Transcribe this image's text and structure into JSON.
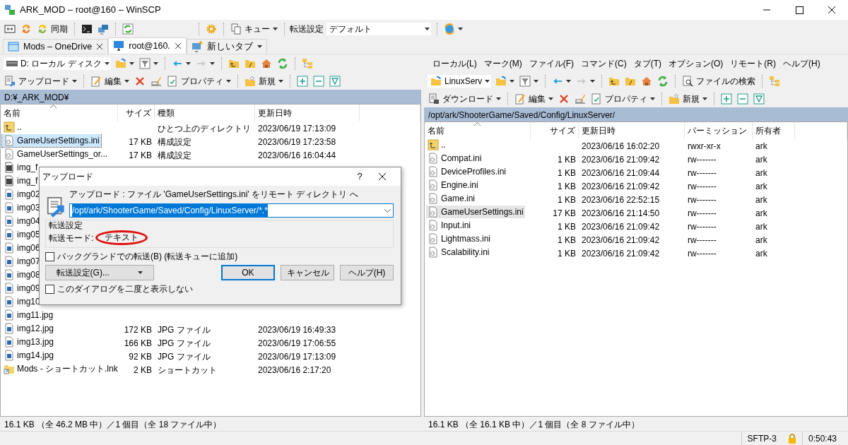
{
  "window": {
    "title": "ARK_MOD – root@160 – WinSCP"
  },
  "main_toolbar": [
    {
      "kind": "icon",
      "dropdown": false
    },
    {
      "kind": "icon",
      "dropdown": false
    },
    {
      "kind": "button",
      "label": "同期",
      "dropdown": false
    },
    {
      "kind": "icon",
      "dropdown": false
    },
    {
      "kind": "icon",
      "dropdown": false
    },
    {
      "kind": "icon",
      "dropdown": false
    },
    {
      "kind": "icon",
      "dropdown": false
    },
    {
      "kind": "button",
      "label": "キュー",
      "dropdown": true
    },
    {
      "kind": "label",
      "label": "転送設定"
    },
    {
      "kind": "combo",
      "value": "デフォルト"
    },
    {
      "kind": "icon",
      "dropdown": true
    }
  ],
  "tabs": [
    {
      "label": "Mods – OneDrive",
      "selected": false,
      "closable": true,
      "dropdown": false
    },
    {
      "label": "root@160.",
      "selected": true,
      "closable": true,
      "dropdown": false
    },
    {
      "label": "新しいタブ",
      "selected": false,
      "closable": false,
      "dropdown": true
    }
  ],
  "left_panel": {
    "toolbar_1": [
      {
        "kind": "combo",
        "value": "D: ローカル ディスク"
      },
      {
        "kind": "icon",
        "dropdown": true
      },
      {
        "kind": "icon",
        "dropdown": true
      },
      {
        "kind": "icon",
        "dropdown": true
      },
      {
        "kind": "icon",
        "dropdown": true
      },
      {
        "kind": "icon",
        "dropdown": false
      },
      {
        "kind": "icon",
        "dropdown": false
      },
      {
        "kind": "icon",
        "dropdown": false
      },
      {
        "kind": "icon",
        "dropdown": false
      },
      {
        "kind": "icon",
        "dropdown": false
      }
    ],
    "toolbar_2": [
      {
        "kind": "button",
        "label": "アップロード",
        "dropdown": true
      },
      {
        "kind": "button",
        "label": "編集",
        "dropdown": true
      },
      {
        "kind": "icon",
        "dropdown": false
      },
      {
        "kind": "icon",
        "dropdown": false
      },
      {
        "kind": "button",
        "label": "プロパティ",
        "dropdown": true
      },
      {
        "kind": "button",
        "label": "新規",
        "dropdown": true
      },
      {
        "kind": "icon",
        "dropdown": false
      },
      {
        "kind": "icon",
        "dropdown": false
      },
      {
        "kind": "icon",
        "dropdown": false
      }
    ],
    "path": "D:¥_ARK_MOD¥",
    "columns": [
      "名前",
      "サイズ",
      "種類",
      "更新日時"
    ],
    "rows": [
      {
        "kind": "parent",
        "selected": false,
        "name": "..",
        "type": "ひとつ上のディレクトリ",
        "modified": "2023/06/19 17:13:09"
      },
      {
        "kind": "config",
        "selected": true,
        "name": "GameUserSettings.ini",
        "size": "17 KB",
        "type": "構成設定",
        "modified": "2023/06/19 17:23:58"
      },
      {
        "kind": "config",
        "selected": false,
        "name": "GameUserSettings_or...",
        "size": "17 KB",
        "type": "構成設定",
        "modified": "2023/06/16 16:04:44"
      },
      {
        "kind": "photo",
        "selected": false,
        "name": "img_f"
      },
      {
        "kind": "photo",
        "selected": false,
        "name": "img_f"
      },
      {
        "kind": "image",
        "selected": false,
        "name": "img02"
      },
      {
        "kind": "image",
        "selected": false,
        "name": "img03"
      },
      {
        "kind": "image",
        "selected": false,
        "name": "img04"
      },
      {
        "kind": "image",
        "selected": false,
        "name": "img05"
      },
      {
        "kind": "image",
        "selected": false,
        "name": "img06"
      },
      {
        "kind": "image",
        "selected": false,
        "name": "img07"
      },
      {
        "kind": "image",
        "selected": false,
        "name": "img08"
      },
      {
        "kind": "image",
        "selected": false,
        "name": "img09"
      },
      {
        "kind": "image",
        "selected": false,
        "name": "img10"
      },
      {
        "kind": "image",
        "selected": false,
        "name": "img11.jpg"
      },
      {
        "kind": "image",
        "selected": false,
        "name": "img12.jpg",
        "size": "172 KB",
        "type": "JPG ファイル",
        "modified": "2023/06/19 16:49:33"
      },
      {
        "kind": "image",
        "selected": false,
        "name": "img13.jpg",
        "size": "166 KB",
        "type": "JPG ファイル",
        "modified": "2023/06/19 17:06:55"
      },
      {
        "kind": "image",
        "selected": false,
        "name": "img14.jpg",
        "size": "92 KB",
        "type": "JPG ファイル",
        "modified": "2023/06/19 17:13:09"
      },
      {
        "kind": "shortcut",
        "selected": false,
        "name": "Mods - ショートカット.lnk",
        "size": "2 KB",
        "type": "ショートカット",
        "modified": "2023/06/16 2:17:20"
      }
    ],
    "status": "16.1 KB （全 46.2 MB 中）／1 個目（全 18 ファイル中）"
  },
  "right_panel": {
    "menu": [
      "ローカル(L)",
      "マーク(M)",
      "ファイル(F)",
      "コマンド(C)",
      "タブ(T)",
      "オプション(O)",
      "リモート(R)",
      "ヘルプ(H)"
    ],
    "toolbar_1": [
      {
        "kind": "combo",
        "value": "LinuxServ"
      },
      {
        "kind": "icon",
        "dropdown": true
      },
      {
        "kind": "icon",
        "dropdown": true
      },
      {
        "kind": "icon",
        "dropdown": true
      },
      {
        "kind": "icon",
        "dropdown": true
      },
      {
        "kind": "icon",
        "dropdown": false
      },
      {
        "kind": "icon",
        "dropdown": false
      },
      {
        "kind": "icon",
        "dropdown": false
      },
      {
        "kind": "icon",
        "dropdown": false
      },
      {
        "kind": "button",
        "label": "ファイルの検索",
        "dropdown": false
      },
      {
        "kind": "icon",
        "dropdown": false
      }
    ],
    "toolbar_2": [
      {
        "kind": "button",
        "label": "ダウンロード",
        "dropdown": true
      },
      {
        "kind": "button",
        "label": "編集",
        "dropdown": true
      },
      {
        "kind": "icon",
        "dropdown": false
      },
      {
        "kind": "icon",
        "dropdown": false
      },
      {
        "kind": "button",
        "label": "プロパティ",
        "dropdown": true
      },
      {
        "kind": "button",
        "label": "新規",
        "dropdown": true
      },
      {
        "kind": "icon",
        "dropdown": false
      },
      {
        "kind": "icon",
        "dropdown": false
      },
      {
        "kind": "icon",
        "dropdown": false
      }
    ],
    "path": "/opt/ark/ShooterGame/Saved/Config/LinuxServer/",
    "columns": [
      "名前",
      "サイズ",
      "更新日時",
      "パーミッション",
      "所有者"
    ],
    "rows": [
      {
        "kind": "parent",
        "selected": false,
        "name": "..",
        "modified": "2023/06/16 16:02:20",
        "permissions": "rwxr-xr-x",
        "owner": "ark"
      },
      {
        "kind": "config",
        "selected": false,
        "name": "Compat.ini",
        "size": "1 KB",
        "modified": "2023/06/16 21:09:42",
        "permissions": "rw-------",
        "owner": "ark"
      },
      {
        "kind": "config",
        "selected": false,
        "name": "DeviceProfiles.ini",
        "size": "1 KB",
        "modified": "2023/06/16 21:09:44",
        "permissions": "rw-------",
        "owner": "ark"
      },
      {
        "kind": "config",
        "selected": false,
        "name": "Engine.ini",
        "size": "1 KB",
        "modified": "2023/06/16 21:09:42",
        "permissions": "rw-------",
        "owner": "ark"
      },
      {
        "kind": "config",
        "selected": false,
        "name": "Game.ini",
        "size": "1 KB",
        "modified": "2023/06/16 22:52:15",
        "permissions": "rw-------",
        "owner": "ark"
      },
      {
        "kind": "config",
        "selected": true,
        "name": "GameUserSettings.ini",
        "size": "17 KB",
        "modified": "2023/06/16 21:14:50",
        "permissions": "rw-------",
        "owner": "ark"
      },
      {
        "kind": "config",
        "selected": false,
        "name": "Input.ini",
        "size": "1 KB",
        "modified": "2023/06/16 21:09:42",
        "permissions": "rw-------",
        "owner": "ark"
      },
      {
        "kind": "config",
        "selected": false,
        "name": "Lightmass.ini",
        "size": "1 KB",
        "modified": "2023/06/16 21:09:42",
        "permissions": "rw-------",
        "owner": "ark"
      },
      {
        "kind": "config",
        "selected": false,
        "name": "Scalability.ini",
        "size": "1 KB",
        "modified": "2023/06/16 21:09:42",
        "permissions": "rw-------",
        "owner": "ark"
      }
    ],
    "status": "16.1 KB （全 16.1 KB 中）／1 個目（全 8 ファイル中）"
  },
  "dialog": {
    "title": "アップロード",
    "help": "?",
    "prompt": "アップロード : ファイル 'GameUserSettings.ini' をリモート ディレクトリ へ",
    "target": "/opt/ark/ShooterGame/Saved/Config/LinuxServer/*.*",
    "group_title": "転送設定",
    "mode_label": "転送モード:",
    "mode_value": "テキスト",
    "mode_highlighted": true,
    "checkboxes": [
      {
        "label": "バックグランドでの転送(B) (転送キューに追加)",
        "checked": false
      },
      {
        "label": "このダイアログを二度と表示しない",
        "checked": false
      }
    ],
    "settings_button": "転送設定(G)...",
    "buttons": [
      {
        "label": "OK",
        "default": true
      },
      {
        "label": "キャンセル",
        "default": false
      },
      {
        "label": "ヘルプ(H)",
        "default": false
      }
    ]
  },
  "status_bar": {
    "session": "SFTP-3",
    "elapsed": "0:50:43"
  }
}
